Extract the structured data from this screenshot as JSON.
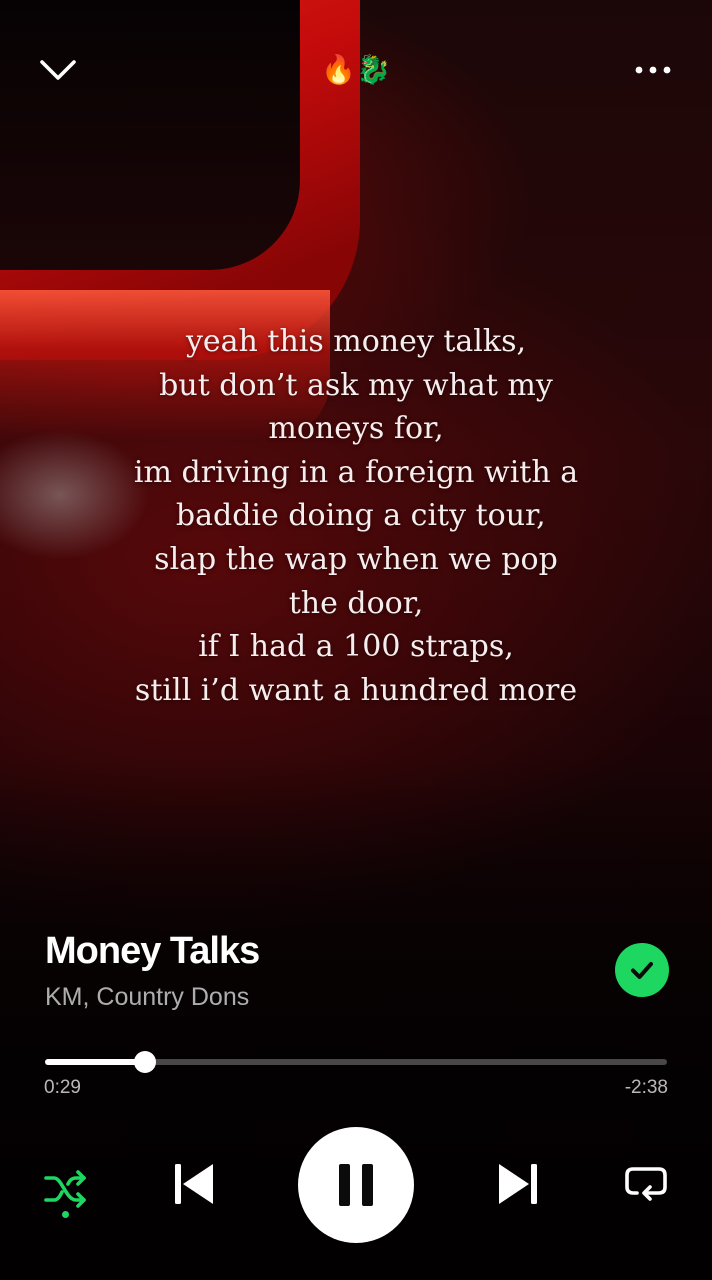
{
  "header": {
    "title": "🔥🐉"
  },
  "lyrics": [
    "yeah this money talks,",
    "but don’t ask my what my",
    "moneys for,",
    "im driving in a foreign with a",
    " baddie doing a city tour,",
    "slap the wap when we pop",
    "the door,",
    "if I had a 100 straps,",
    "still i’d want a hundred more"
  ],
  "track": {
    "title": "Money Talks",
    "artist": "KM, Country Dons",
    "liked": true
  },
  "playback": {
    "elapsed": "0:29",
    "remaining": "-2:38",
    "progress_fraction": 0.16,
    "state": "playing",
    "shuffle": true,
    "repeat": false
  },
  "colors": {
    "accent": "#1ed760",
    "background": "#1a0406"
  },
  "icons": {
    "collapse": "chevron-down-icon",
    "more": "more-horizontal-icon",
    "liked": "check-icon",
    "shuffle": "shuffle-icon",
    "previous": "skip-back-icon",
    "pause": "pause-icon",
    "next": "skip-forward-icon",
    "repeat": "repeat-icon"
  }
}
